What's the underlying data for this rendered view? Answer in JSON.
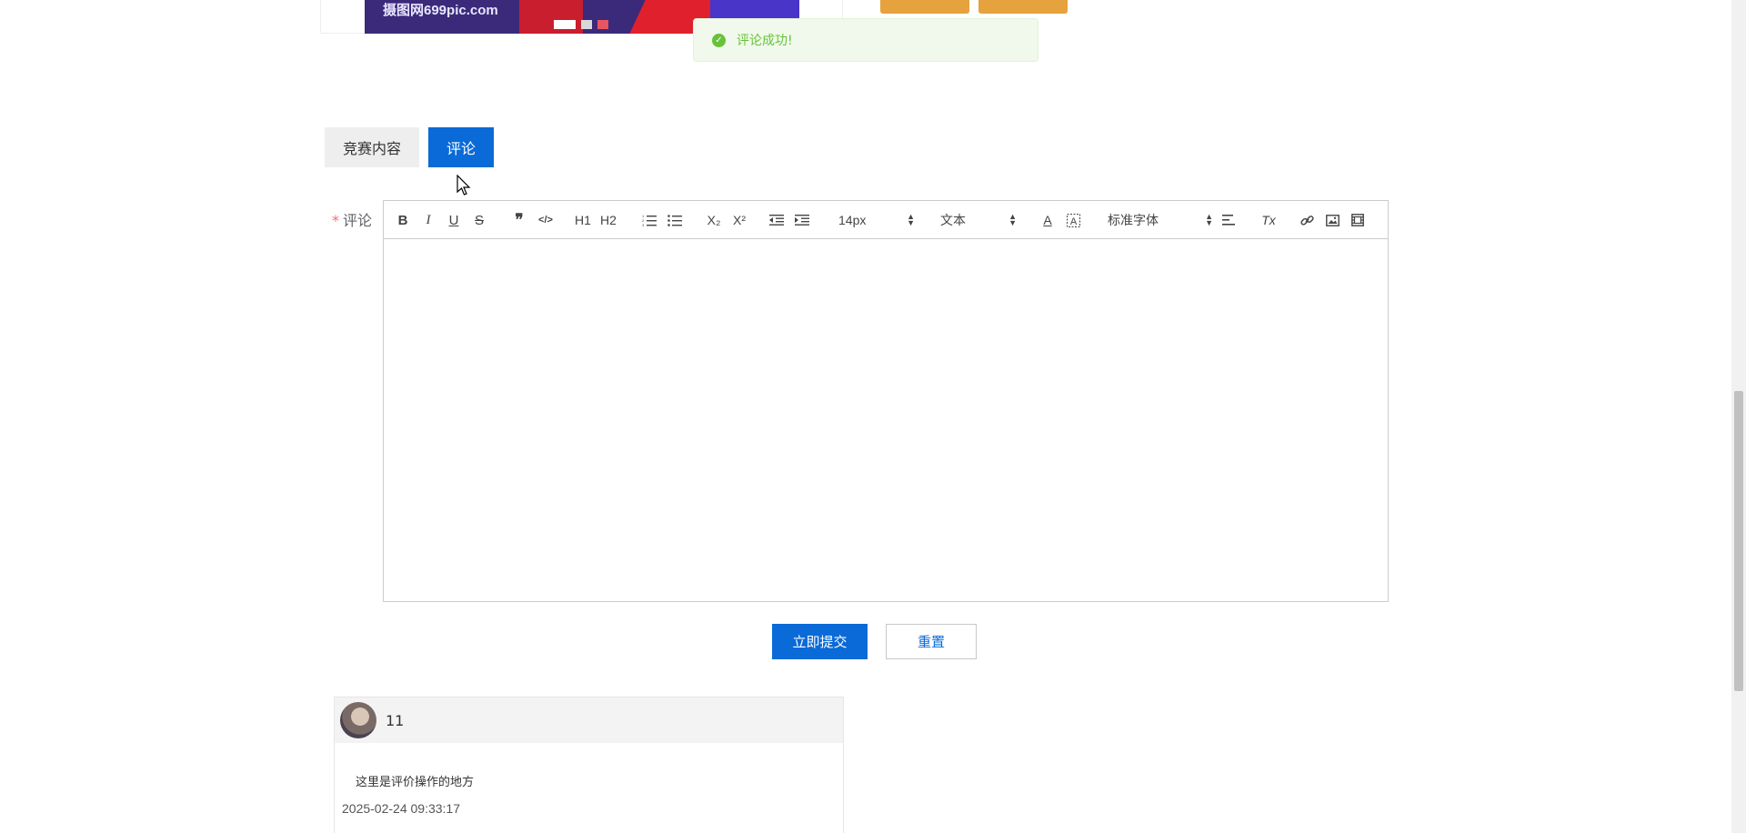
{
  "banner": {
    "watermark": "摄图网699pic.com",
    "colors": {
      "bg": "#3b2a7a",
      "red": "#e0202c"
    }
  },
  "toast": {
    "message": "评论成功!",
    "icon": "check-circle-icon",
    "color": "#67c23a"
  },
  "tabs": [
    {
      "label": "竞赛内容",
      "active": false
    },
    {
      "label": "评论",
      "active": true
    }
  ],
  "form": {
    "required_mark": "*",
    "comment_label": "评论"
  },
  "editor": {
    "toolbar": {
      "bold": "B",
      "italic": "I",
      "underline": "U",
      "strike": "S",
      "quote": "❞",
      "code": "</>",
      "h1": "H1",
      "h2": "H2",
      "ordered_list": "ordered-list-icon",
      "bullet_list": "bullet-list-icon",
      "subscript": "X₂",
      "superscript": "X²",
      "outdent": "outdent-icon",
      "indent": "indent-icon",
      "size_value": "14px",
      "header_value": "文本",
      "font_value": "标准字体",
      "color": "A",
      "background": "A",
      "align": "align-left-icon",
      "clean": "Tx",
      "link": "link-icon",
      "image": "image-icon",
      "video": "video-icon"
    },
    "content": ""
  },
  "buttons": {
    "submit_label": "立即提交",
    "reset_label": "重置"
  },
  "comments": [
    {
      "user": "11",
      "text": "这里是评价操作的地方",
      "time": "2025-02-24 09:33:17"
    }
  ],
  "theme": {
    "primary": "#0a6ad7",
    "warning": "#e6a23c",
    "danger": "#f56c6c"
  }
}
